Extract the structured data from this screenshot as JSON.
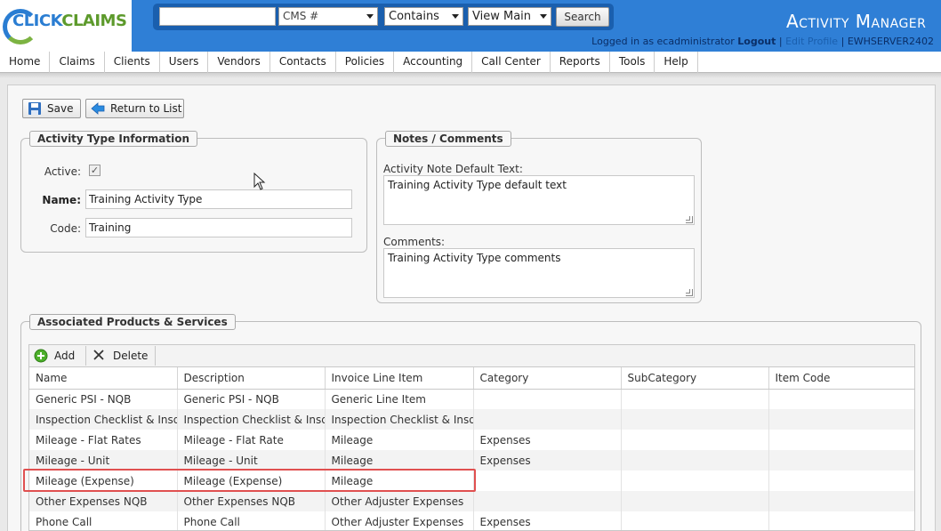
{
  "brand": {
    "logo_part1": "CLICK",
    "logo_part2": "CLAIMS"
  },
  "header": {
    "title": "Activity Manager",
    "search_value": "",
    "search_field_select": "CMS #",
    "match_select": "Contains",
    "view_select": "View Main",
    "search_button": "Search",
    "logged_in_text": "Logged in as ecadministrator",
    "logout_link": "Logout",
    "separator": "|",
    "edit_profile_link": "Edit Profile",
    "server": "EWHSERVER2402"
  },
  "menu": [
    "Home",
    "Claims",
    "Clients",
    "Users",
    "Vendors",
    "Contacts",
    "Policies",
    "Accounting",
    "Call Center",
    "Reports",
    "Tools",
    "Help"
  ],
  "toolbar": {
    "save_label": "Save",
    "return_label": "Return to List"
  },
  "activity_type": {
    "legend": "Activity Type Information",
    "active_label": "Active:",
    "active_checked": true,
    "name_label": "Name:",
    "name_value": "Training Activity Type",
    "code_label": "Code:",
    "code_value": "Training"
  },
  "notes": {
    "legend": "Notes / Comments",
    "default_text_label": "Activity Note Default Text:",
    "default_text_value": "Training Activity Type default text",
    "comments_label": "Comments:",
    "comments_value": "Training Activity Type comments"
  },
  "products": {
    "legend": "Associated Products & Services",
    "add_label": "Add",
    "delete_label": "Delete",
    "columns": [
      "Name",
      "Description",
      "Invoice Line Item",
      "Category",
      "SubCategory",
      "Item Code"
    ],
    "rows": [
      [
        "Generic PSI - NQB",
        "Generic PSI - NQB",
        "Generic Line Item",
        "",
        "",
        ""
      ],
      [
        "Inspection Checklist & Insd Sig",
        "Inspection Checklist & Insd Sig",
        "Inspection Checklist & Insd Sig",
        "",
        "",
        ""
      ],
      [
        "Mileage - Flat Rates",
        "Mileage - Flat Rate",
        "Mileage",
        "Expenses",
        "",
        ""
      ],
      [
        "Mileage - Unit",
        "Mileage - Unit",
        "Mileage",
        "Expenses",
        "",
        ""
      ],
      [
        "Mileage (Expense)",
        "Mileage (Expense)",
        "Mileage",
        "",
        "",
        ""
      ],
      [
        "Other Expenses NQB",
        "Other Expenses NQB",
        "Other Adjuster Expenses",
        "",
        "",
        ""
      ],
      [
        "Phone Call",
        "Phone Call",
        "Other Adjuster Expenses",
        "Expenses",
        "",
        ""
      ]
    ]
  },
  "colors": {
    "header_blue": "#2f7fd6",
    "highlight_red": "#e05050"
  }
}
